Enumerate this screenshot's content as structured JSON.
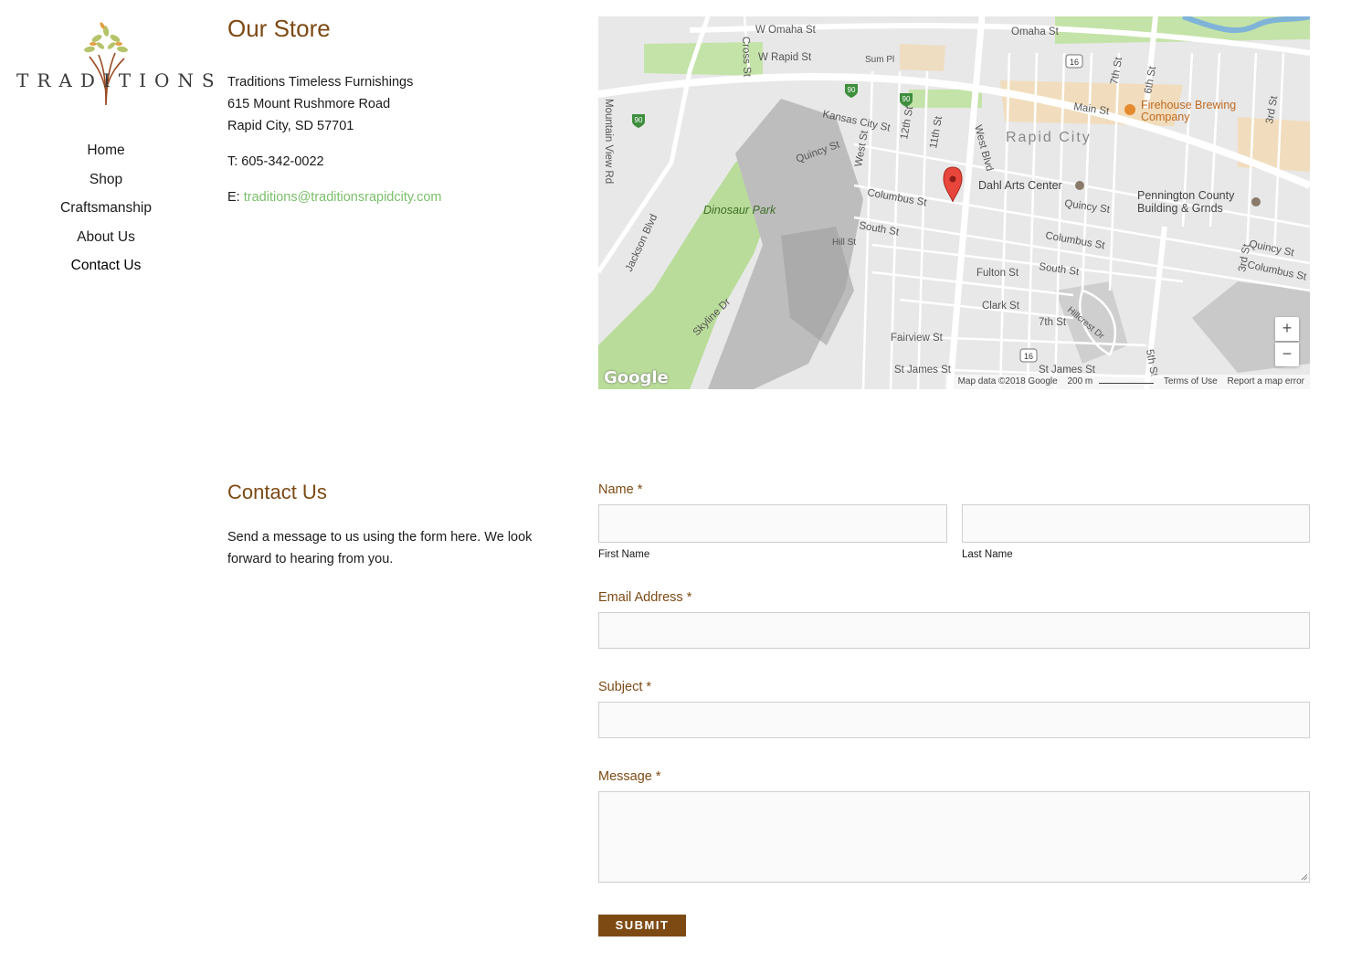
{
  "brand": {
    "logo_text": "TRADITIONS",
    "accent_color": "#7d4a14",
    "link_color": "#7bbf6a"
  },
  "nav": {
    "items": [
      {
        "label": "Home"
      },
      {
        "label": "Shop"
      },
      {
        "label": "Craftsmanship"
      },
      {
        "label": "About Us"
      },
      {
        "label": "Contact Us"
      }
    ]
  },
  "store": {
    "title": "Our Store",
    "name": "Traditions Timeless Furnishings",
    "street": "615 Mount Rushmore Road",
    "city": "Rapid City, SD 57701",
    "phone": "T: 605-342-0022",
    "email_prefix": "E:",
    "email": "traditions@traditionsrapidcity.com"
  },
  "map": {
    "labels": {
      "w_omaha": "W Omaha St",
      "omaha": "Omaha St",
      "w_rapid": "W Rapid St",
      "sum_pl": "Sum Pl",
      "kansas_city": "Kansas City St",
      "main": "Main St",
      "rapid_city": "Rapid City",
      "firehouse": "Firehouse Brewing",
      "firehouse2": "Company",
      "dahl": "Dahl Arts Center",
      "quincy": "Quincy St",
      "quincy2": "Quincy St",
      "quincy3": "Quincy St",
      "columbus": "Columbus St",
      "columbus2": "Columbus St",
      "columbus3": "Columbus St",
      "pennington": "Pennington County",
      "pennington2": "Building & Grnds",
      "dinosaur": "Dinosaur Park",
      "south": "South St",
      "south2": "South St",
      "hill": "Hill St",
      "fulton": "Fulton St",
      "clark": "Clark St",
      "seventh": "7th St",
      "fairview": "Fairview St",
      "st_james": "St James St",
      "st_james2": "St James St",
      "skyline": "Skyline Dr",
      "jackson": "Jackson Blvd",
      "mountain_view": "Mountain View Rd",
      "west_blvd": "West Blvd",
      "west_st": "West St",
      "twelfth": "12th St",
      "eleventh": "11th St",
      "cross": "Cross St",
      "hillcrest": "Hillcrest Dr",
      "fifth": "5th St",
      "sixth": "6th St",
      "seventh_v": "7th St",
      "third": "3rd St",
      "third2": "3rd St",
      "sh16": "16",
      "i90": "90"
    },
    "zoom_in": "+",
    "zoom_out": "−",
    "google": "Google",
    "attribution": "Map data ©2018 Google",
    "scale": "200 m",
    "terms": "Terms of Use",
    "report": "Report a map error"
  },
  "contact": {
    "title": "Contact Us",
    "description": "Send a message to us using the form here. We look forward to hearing from you.",
    "name_label": "Name *",
    "first_name": "First Name",
    "last_name": "Last Name",
    "email_label": "Email Address *",
    "subject_label": "Subject *",
    "message_label": "Message *",
    "submit": "SUBMIT"
  }
}
